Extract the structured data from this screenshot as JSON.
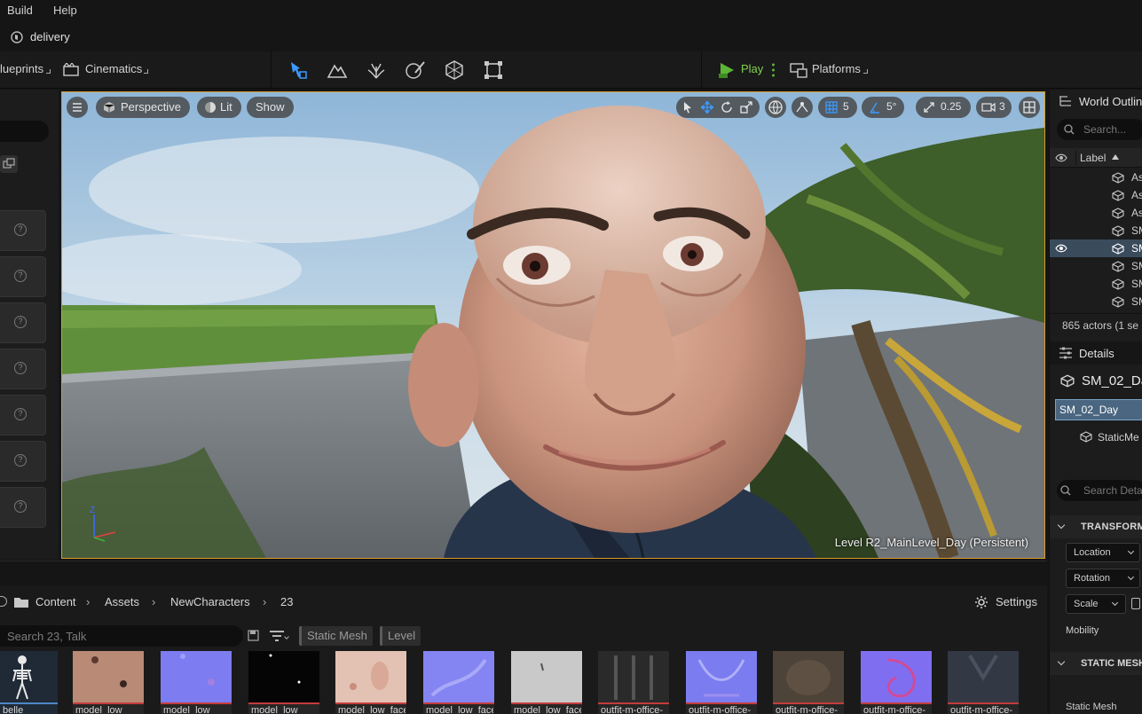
{
  "menu": {
    "build": "Build",
    "help": "Help"
  },
  "project": {
    "name": "delivery"
  },
  "toolbar": {
    "blueprints": "lueprints",
    "cinematics": "Cinematics",
    "play": "Play",
    "platforms": "Platforms",
    "accent": "#4aa3ff",
    "play_color": "#5db536"
  },
  "viewport": {
    "perspective": "Perspective",
    "lit": "Lit",
    "show": "Show",
    "grid_snap": "5",
    "angle_snap": "5°",
    "scale_snap": "0.25",
    "camera_speed": "3",
    "level_label": "Level  R2_MainLevel_Day (Persistent)",
    "axis_z": "Z",
    "selection_outline": "#d89a28"
  },
  "outliner": {
    "title": "World Outline",
    "search_placeholder": "Search...",
    "label_header": "Label",
    "rows": [
      "As",
      "As",
      "As",
      "SM",
      "SM",
      "SM",
      "SM",
      "SM"
    ],
    "selected_index": 4,
    "actor_count": "865 actors (1 se"
  },
  "details": {
    "title": "Details",
    "actor_name": "SM_02_Da",
    "component_selected": "SM_02_Day",
    "component_child": "StaticMe",
    "search_placeholder": "Search Deta",
    "transform_header": "TRANSFORM",
    "location": "Location",
    "rotation": "Rotation",
    "scale": "Scale",
    "mobility": "Mobility",
    "static_mesh_header": "STATIC MESH",
    "static_mesh_label": "Static Mesh"
  },
  "content_browser": {
    "breadcrumb": [
      "Content",
      "Assets",
      "NewCharacters",
      "23"
    ],
    "settings": "Settings",
    "search_placeholder": "Search 23, Talk",
    "filters": [
      "Static Mesh",
      "Level"
    ],
    "assets": [
      {
        "name": "belle",
        "color": "#1c2530"
      },
      {
        "name": "model_low",
        "color": "#b98a75"
      },
      {
        "name": "model_low",
        "color": "#7d7cf0"
      },
      {
        "name": "model_low",
        "color": "#050505"
      },
      {
        "name": "model_low_face",
        "color": "#e3c2b3"
      },
      {
        "name": "model_low_face",
        "color": "#8485f2"
      },
      {
        "name": "model_low_face",
        "color": "#c9c9c9"
      },
      {
        "name": "outfit-m-office-",
        "color": "#2a2a2a"
      },
      {
        "name": "outfit-m-office-",
        "color": "#7b7cf0"
      },
      {
        "name": "outfit-m-office-",
        "color": "#4e4338"
      },
      {
        "name": "outfit-m-office-",
        "color": "#7f6ff0"
      },
      {
        "name": "outfit-m-office-",
        "color": "#323944"
      }
    ]
  }
}
